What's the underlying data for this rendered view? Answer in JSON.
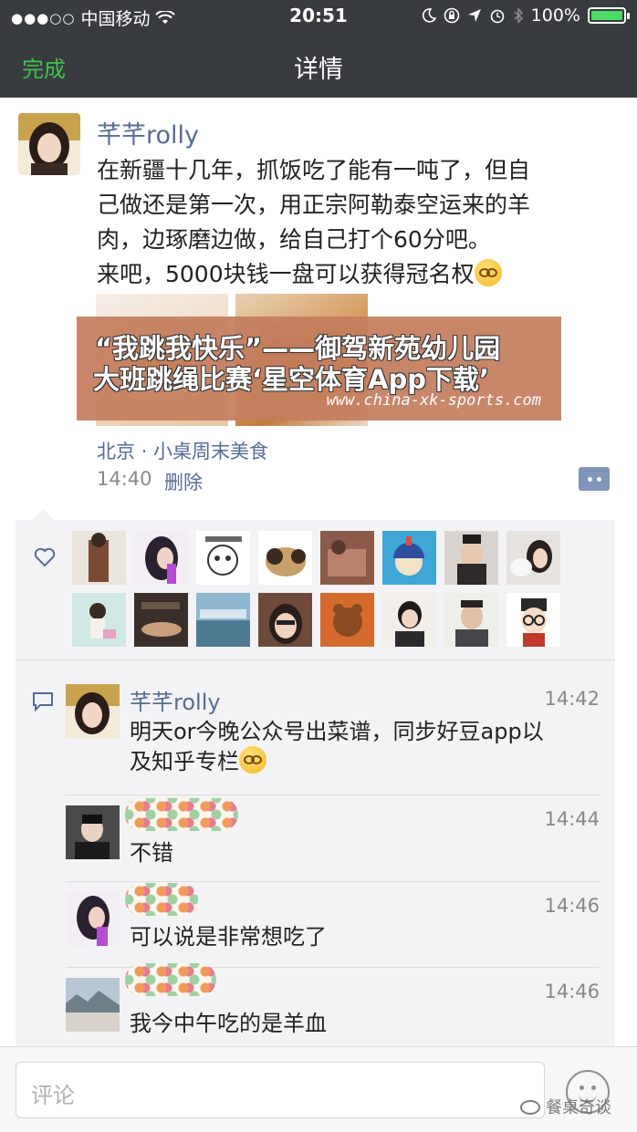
{
  "status_bar": {
    "signal": "●●●○○",
    "carrier": "中国移动",
    "time": "20:51",
    "battery": "100%",
    "battery_level": 1.0
  },
  "nav": {
    "done_label": "完成",
    "title": "详情"
  },
  "post": {
    "author": "芊芊rolly",
    "text_lines": [
      "在新疆十几年，抓饭吃了能有一吨了，但自",
      "己做还是第一次，用正宗阿勒泰空运来的羊",
      "肉，边琢磨边做，给自己打个60分吧。",
      "来吧，5000块钱一盘可以获得冠名权"
    ],
    "location": "北京 · 小桌周末美食",
    "time": "14:40",
    "delete_label": "删除"
  },
  "overlay_banner": {
    "line1": "“我跳我快乐”——御驾新苑幼儿园",
    "line2": "大班跳绳比赛‘星空体育App下载’",
    "url": "www.china-xk-sports.com"
  },
  "comments": [
    {
      "author": "芊芊rolly",
      "time": "14:42",
      "lines": [
        "明天or今晚公众号出菜谱，同步好豆app以",
        "及知乎专栏"
      ]
    },
    {
      "author": "",
      "time": "14:44",
      "lines": [
        "不错"
      ]
    },
    {
      "author": "",
      "time": "14:46",
      "lines": [
        "可以说是非常想吃了"
      ]
    },
    {
      "author": "",
      "time": "14:46",
      "lines": [
        "我今中午吃的是羊血"
      ]
    }
  ],
  "bottom_bar": {
    "comment_placeholder": "评论",
    "watermark": "餐桌奇谈"
  },
  "colors": {
    "nav_bg": "#383c3f",
    "done_green": "#3ec24b",
    "link_blue": "#576b95",
    "panel_bg": "#f3f3f5"
  }
}
